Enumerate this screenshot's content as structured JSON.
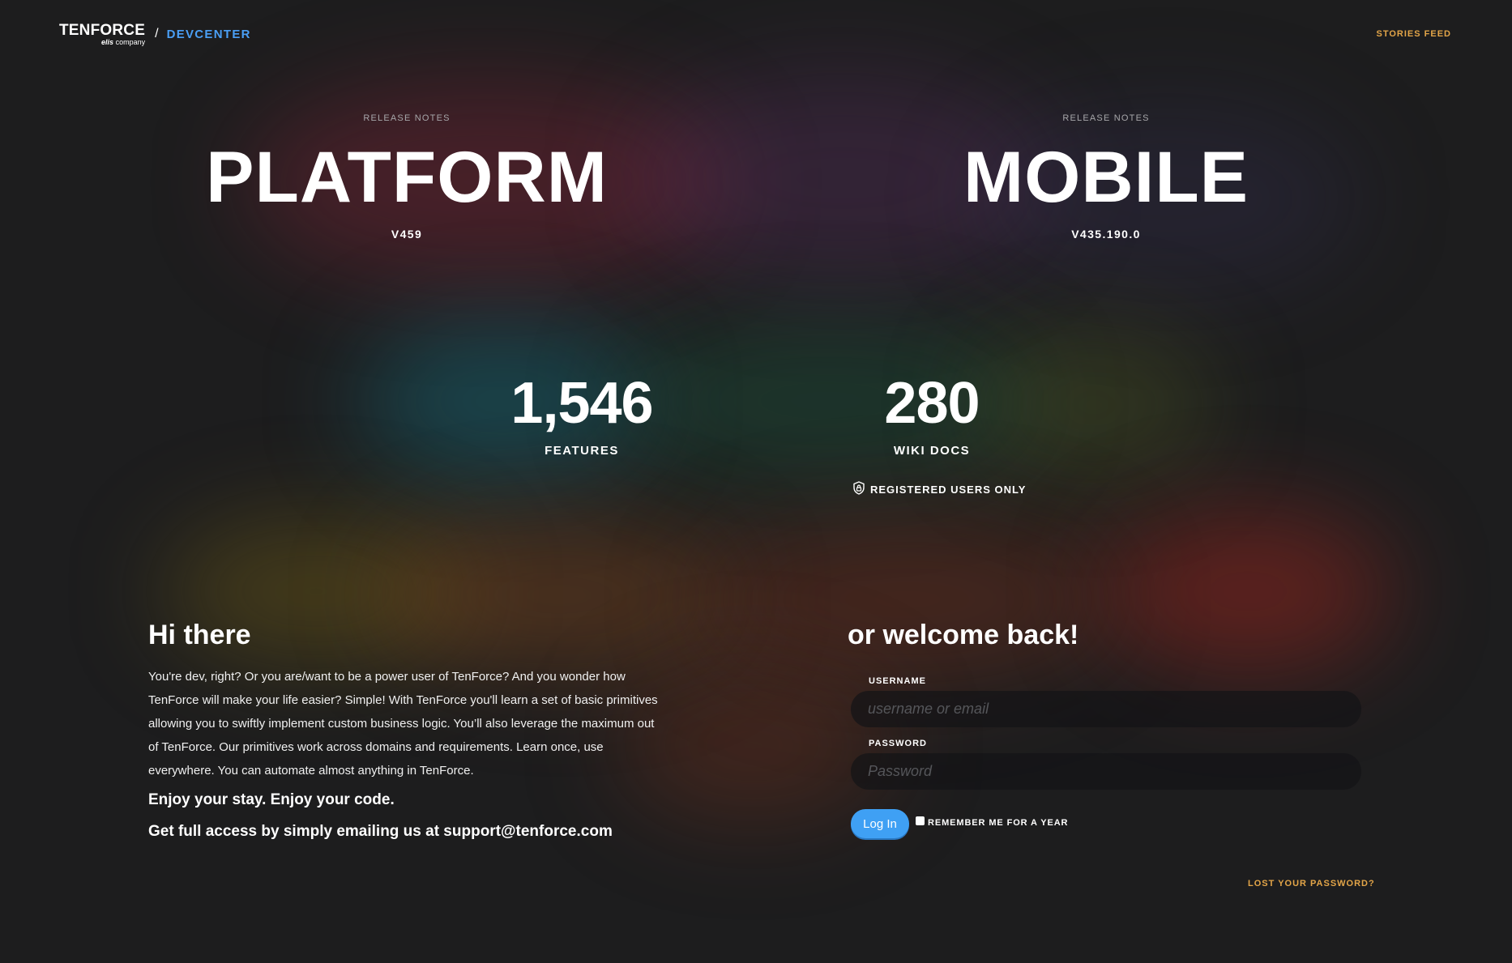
{
  "header": {
    "logo_main": "TENFORCE",
    "logo_sub_brand": "elis",
    "logo_sub_text": "company",
    "separator": "/",
    "section": "DEVCENTER",
    "stories_link": "STORIES FEED"
  },
  "releases": [
    {
      "label": "RELEASE NOTES",
      "name": "PLATFORM",
      "version": "V459"
    },
    {
      "label": "RELEASE NOTES",
      "name": "MOBILE",
      "version": "V435.190.0"
    }
  ],
  "stats": [
    {
      "value": "1,546",
      "label": "FEATURES"
    },
    {
      "value": "280",
      "label": "WIKI DOCS"
    }
  ],
  "registered_notice": "REGISTERED USERS ONLY",
  "intro": {
    "title": "Hi there",
    "body": "You're dev, right? Or you are/want to be a power user of TenForce? And you wonder how TenForce will make your life easier? Simple! With TenForce you'll learn a set of basic primitives allowing you to swiftly implement custom business logic. You’ll also leverage the maximum out of TenForce. Our primitives work across domains and requirements. Learn once, use everywhere. You can automate almost anything in TenForce.",
    "tagline": "Enjoy your stay. Enjoy your code.",
    "access": "Get full access by simply emailing us at support@tenforce.com"
  },
  "login": {
    "title": "or welcome back!",
    "username_label": "USERNAME",
    "username_placeholder": "username or email",
    "username_value": "",
    "password_label": "PASSWORD",
    "password_placeholder": "Password",
    "password_value": "",
    "submit_label": "Log In",
    "remember_label": "REMEMBER ME FOR A YEAR",
    "remember_checked": false,
    "lost_password": "LOST YOUR PASSWORD?"
  },
  "colors": {
    "background": "#1d1d1e",
    "accent_blue": "#4a9ff5",
    "button_blue": "#3fa0f4",
    "link_orange": "#e3a548"
  }
}
